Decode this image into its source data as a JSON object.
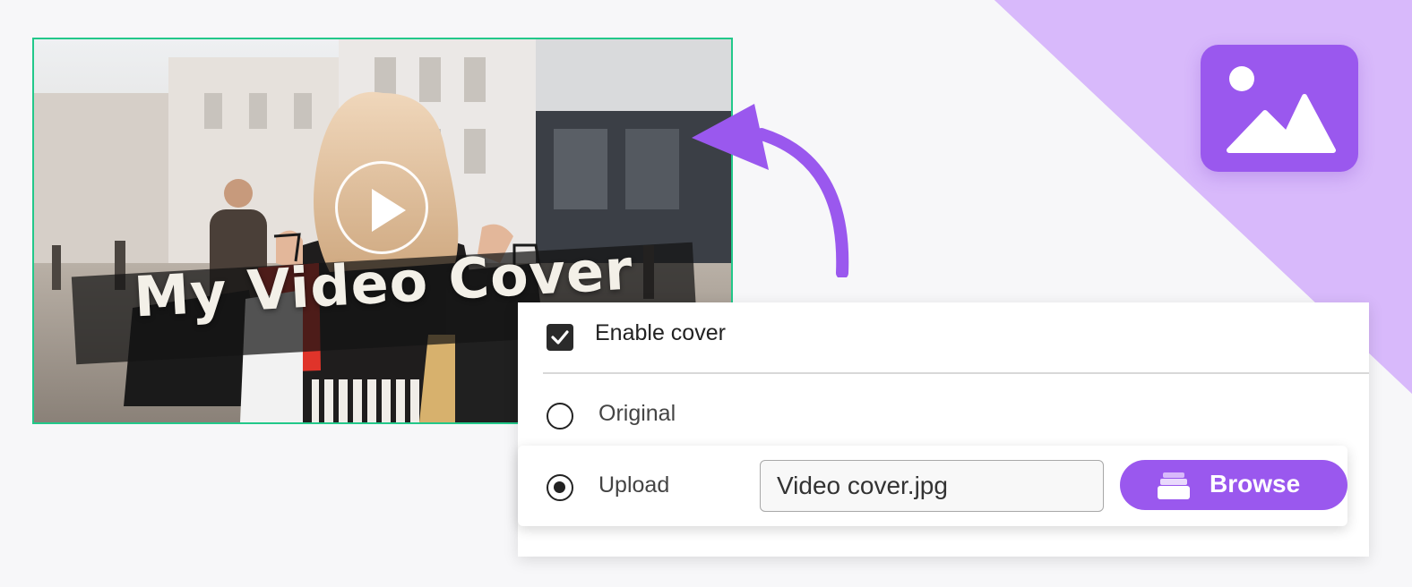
{
  "colors": {
    "accent": "#9a58ee",
    "accent_light": "#d8b9fb",
    "frame_border": "#22c88a",
    "background": "#f7f7f9"
  },
  "video_preview": {
    "title_text": "My Video Cover",
    "play_icon": "play-icon"
  },
  "badge": {
    "icon": "image-icon"
  },
  "settings": {
    "enable_label": "Enable cover",
    "enable_checked": true,
    "options": {
      "original_label": "Original",
      "upload_label": "Upload",
      "selected": "Upload"
    },
    "file_value": "Video cover.jpg",
    "browse_label": "Browse",
    "browse_icon": "folder-stack-icon"
  }
}
